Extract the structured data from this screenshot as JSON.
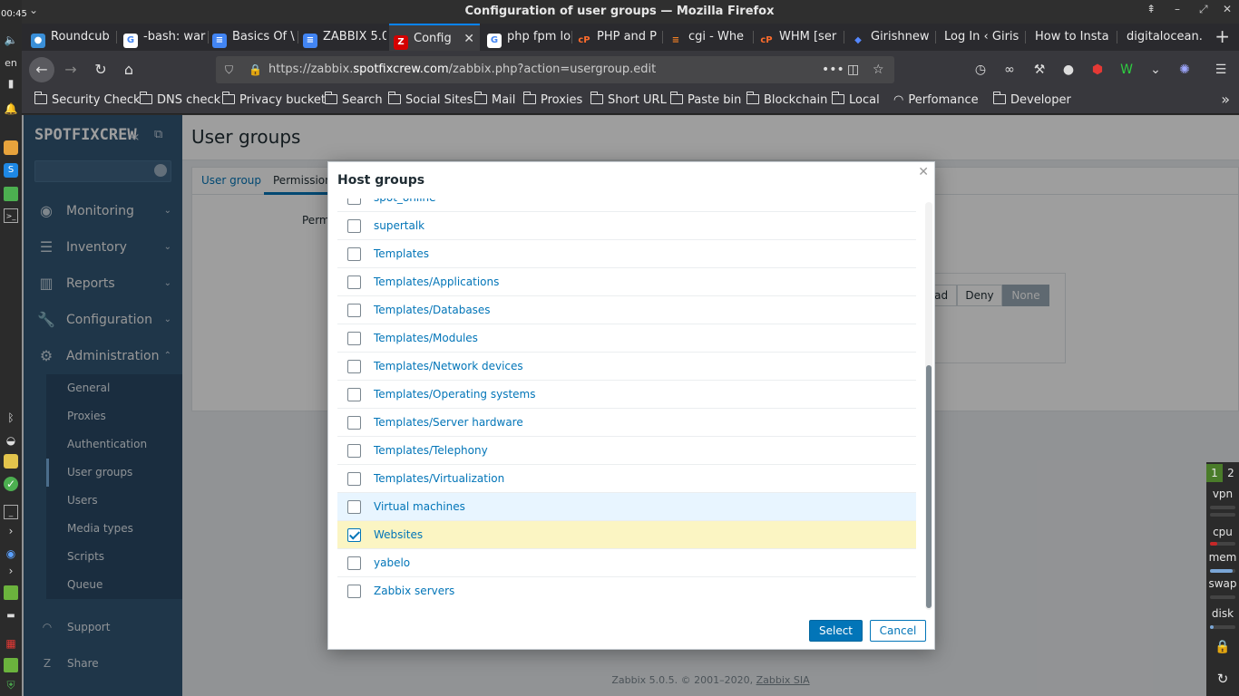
{
  "window": {
    "title": "Configuration of user groups — Mozilla Firefox"
  },
  "ospanel": {
    "clock": "00:45",
    "lang": "en"
  },
  "tabs": [
    {
      "label": "Roundcub",
      "fav_color": "#3a8fd8",
      "fav_char": "●"
    },
    {
      "label": "-bash: war",
      "fav_color": "#ffffff",
      "fav_char": "G"
    },
    {
      "label": "Basics Of \\",
      "fav_color": "#4285f4",
      "fav_char": "≡"
    },
    {
      "label": "ZABBIX 5.0",
      "fav_color": "#4285f4",
      "fav_char": "≡"
    },
    {
      "label": "Config",
      "fav_color": "#d40000",
      "fav_char": "Z",
      "active": true
    },
    {
      "label": "php fpm lo",
      "fav_color": "#ffffff",
      "fav_char": "G"
    },
    {
      "label": "PHP and P",
      "fav_color": "#ff6c2c",
      "fav_char": "cP"
    },
    {
      "label": "cgi - Whe",
      "fav_color": "#f48024",
      "fav_char": "≡"
    },
    {
      "label": "WHM [ser",
      "fav_color": "#ff6c2c",
      "fav_char": "cP"
    },
    {
      "label": "Girishnew",
      "fav_color": "#2255cc",
      "fav_char": "◆"
    },
    {
      "label": "Log In ‹ Girish",
      "fav_color": "",
      "fav_char": ""
    },
    {
      "label": "How to Install",
      "fav_color": "",
      "fav_char": ""
    },
    {
      "label": "digitalocean.c",
      "fav_color": "",
      "fav_char": ""
    }
  ],
  "url": {
    "prefix": "https://zabbix.",
    "domain": "spotfixcrew.com",
    "path": "/zabbix.php?action=usergroup.edit"
  },
  "bookmarks": [
    "Security Check",
    "DNS check",
    "Privacy bucket",
    "Search",
    "Social Sites",
    "Mail",
    "Proxies",
    "Short URL",
    "Paste bin",
    "Blockchain",
    "Local",
    "Perfomance",
    "Developer"
  ],
  "zabbix": {
    "logo": "SPOTFIXCREW",
    "nav": {
      "monitoring": "Monitoring",
      "inventory": "Inventory",
      "reports": "Reports",
      "configuration": "Configuration",
      "administration": "Administration"
    },
    "admin_sub": [
      "General",
      "Proxies",
      "Authentication",
      "User groups",
      "Users",
      "Media types",
      "Scripts",
      "Queue"
    ],
    "active_sub": "User groups",
    "support": "Support",
    "share": "Share",
    "page_title": "User groups",
    "tabs": {
      "user_group": "User group",
      "permissions": "Permissions"
    },
    "perm_label": "Perm",
    "perm_buttons": {
      "read": "Read",
      "deny": "Deny",
      "none": "None"
    },
    "footer": {
      "text": "Zabbix 5.0.5. © 2001–2020, ",
      "link": "Zabbix SIA"
    }
  },
  "modal": {
    "title": "Host groups",
    "items": [
      {
        "label": "spot_online",
        "checked": false
      },
      {
        "label": "supertalk",
        "checked": false
      },
      {
        "label": "Templates",
        "checked": false
      },
      {
        "label": "Templates/Applications",
        "checked": false
      },
      {
        "label": "Templates/Databases",
        "checked": false
      },
      {
        "label": "Templates/Modules",
        "checked": false
      },
      {
        "label": "Templates/Network devices",
        "checked": false
      },
      {
        "label": "Templates/Operating systems",
        "checked": false
      },
      {
        "label": "Templates/Server hardware",
        "checked": false
      },
      {
        "label": "Templates/Telephony",
        "checked": false
      },
      {
        "label": "Templates/Virtualization",
        "checked": false
      },
      {
        "label": "Virtual machines",
        "checked": false,
        "hover": true
      },
      {
        "label": "Websites",
        "checked": true
      },
      {
        "label": "yabelo",
        "checked": false
      },
      {
        "label": "Zabbix servers",
        "checked": false
      }
    ],
    "select_label": "Select",
    "cancel_label": "Cancel"
  },
  "sysmon": {
    "workspaces": [
      "1",
      "2"
    ],
    "labels": {
      "vpn": "vpn",
      "cpu": "cpu",
      "mem": "mem",
      "swap": "swap",
      "disk": "disk"
    },
    "levels": {
      "cpu": 0.3,
      "mem": 0.9,
      "swap": 0.0,
      "disk": 0.15
    }
  }
}
